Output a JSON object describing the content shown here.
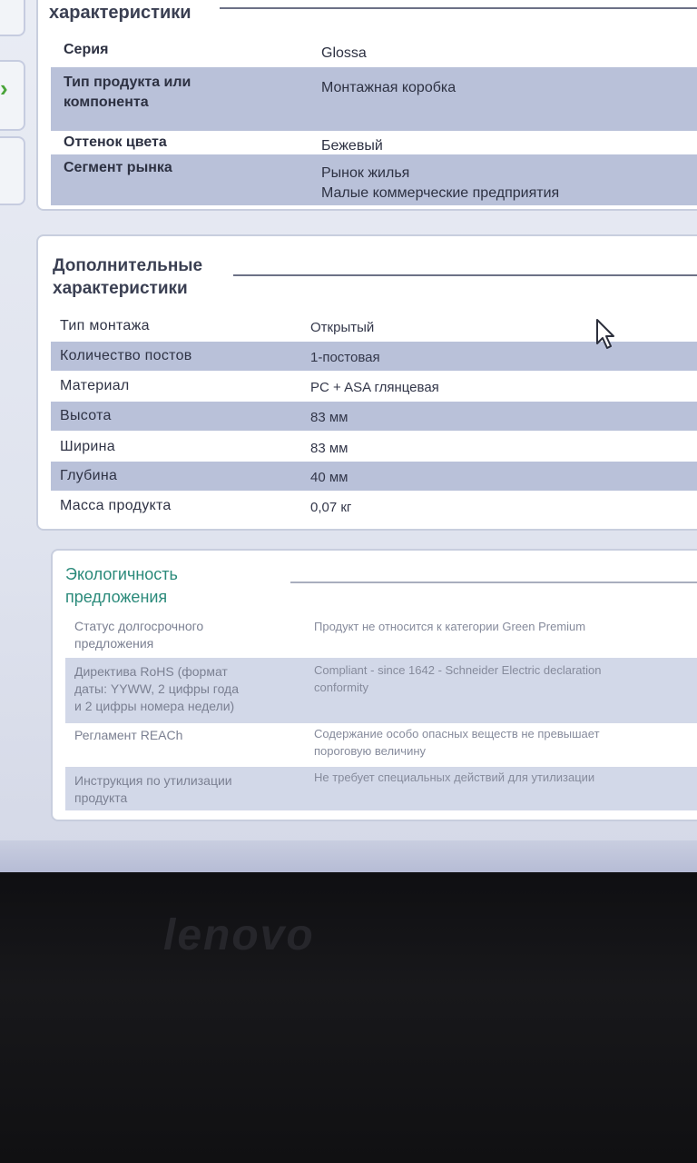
{
  "panel_main": {
    "title": "характеристики",
    "rows": [
      {
        "label": "Серия",
        "value": "Glossa"
      },
      {
        "label": "Тип продукта или\nкомпонента",
        "value": "Монтажная коробка"
      },
      {
        "label": "Оттенок цвета",
        "value": "Бежевый"
      },
      {
        "label": "Сегмент рынка",
        "value": "Рынок жилья\nМалые коммерческие предприятия"
      }
    ]
  },
  "panel_additional": {
    "title": "Дополнительные\nхарактеристики",
    "rows": [
      {
        "label": "Тип монтажа",
        "value": "Открытый"
      },
      {
        "label": "Количество постов",
        "value": "1-постовая"
      },
      {
        "label": "Материал",
        "value": "PC + ASA глянцевая"
      },
      {
        "label": "Высота",
        "value": "83 мм"
      },
      {
        "label": "Ширина",
        "value": "83 мм"
      },
      {
        "label": "Глубина",
        "value": "40 мм"
      },
      {
        "label": "Масса продукта",
        "value": "0,07 кг"
      }
    ]
  },
  "panel_eco": {
    "title": "Экологичность\nпредложения",
    "rows": [
      {
        "label": "Статус долгосрочного\nпредложения",
        "value": "Продукт не относится к категории Green Premium"
      },
      {
        "label": "Директива RoHS (формат\nдаты: YYWW, 2 цифры года\nи 2 цифры номера недели)",
        "value": "Compliant - since 1642 - Schneider Electric declaration\nconformity"
      },
      {
        "label": "Регламент REACh",
        "value": "Содержание особо опасных веществ не превышает\nпороговую величину"
      },
      {
        "label": "Инструкция по утилизации\nпродукта",
        "value": "Не требует специальных действий для утилизации"
      }
    ]
  },
  "device": {
    "logo": "lenovo"
  },
  "icons": {
    "tab_arrow": "chevron-right-icon",
    "cursor": "mouse-pointer-icon"
  },
  "colors": {
    "row_alt": "#b9c1d9",
    "eco_title": "#2a8a7a",
    "tab_arrow": "#4aa43a"
  }
}
